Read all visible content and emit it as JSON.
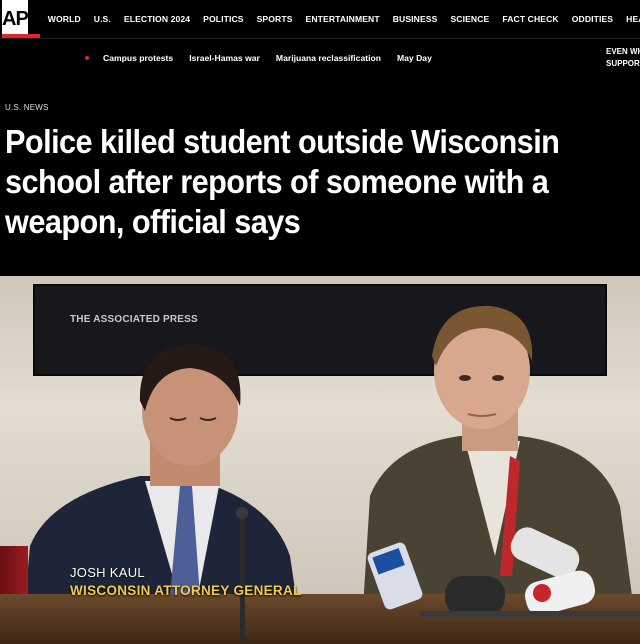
{
  "header": {
    "logo_text": "AP",
    "nav": [
      "WORLD",
      "U.S.",
      "ELECTION 2024",
      "POLITICS",
      "SPORTS",
      "ENTERTAINMENT",
      "BUSINESS",
      "SCIENCE",
      "FACT CHECK",
      "ODDITIES",
      "HEALTH"
    ]
  },
  "trending": {
    "items": [
      "Campus protests",
      "Israel-Hamas war",
      "Marijuana reclassification",
      "May Day"
    ],
    "right_text_line1": "EVEN WH",
    "right_text_line2": "SUPPORT"
  },
  "article": {
    "section": "U.S. NEWS",
    "headline": "Police killed student outside Wisconsin school after reports of someone with a weapon, official says"
  },
  "video": {
    "watermark": "THE ASSOCIATED PRESS",
    "lower_third_name": "JOSH KAUL",
    "lower_third_title": "WISCONSIN ATTORNEY GENERAL"
  },
  "colors": {
    "accent_red": "#e2262a",
    "lower_third_yellow": "#f2c94c",
    "background": "#000000"
  }
}
